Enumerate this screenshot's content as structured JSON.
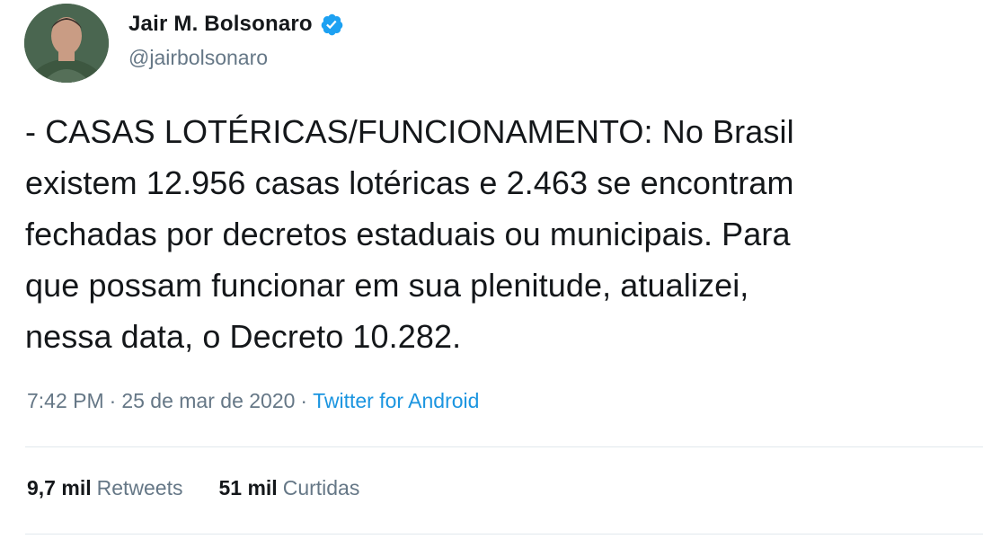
{
  "author": {
    "display_name": "Jair M. Bolsonaro",
    "handle": "@jairbolsonaro",
    "verified": true,
    "avatar_icon": "profile-photo-icon",
    "verified_icon": "verified-badge-icon"
  },
  "tweet": {
    "text": "- CASAS LOTÉRICAS/FUNCIONAMENTO: No Brasil\nexistem 12.956 casas lotéricas e 2.463 se encontram\nfechadas por decretos estaduais ou municipais. Para\nque possam funcionar em sua plenitude, atualizei,\nnessa data, o Decreto 10.282."
  },
  "meta": {
    "time": "7:42 PM",
    "separator": "·",
    "date": "25 de mar de 2020",
    "source": "Twitter for Android"
  },
  "stats": {
    "retweets_count": "9,7 mil",
    "retweets_label": "Retweets",
    "likes_count": "51 mil",
    "likes_label": "Curtidas"
  },
  "colors": {
    "text": "#14171a",
    "secondary": "#657786",
    "link": "#1b95e0",
    "verified": "#1da1f2",
    "divider": "#e1e8ed"
  }
}
